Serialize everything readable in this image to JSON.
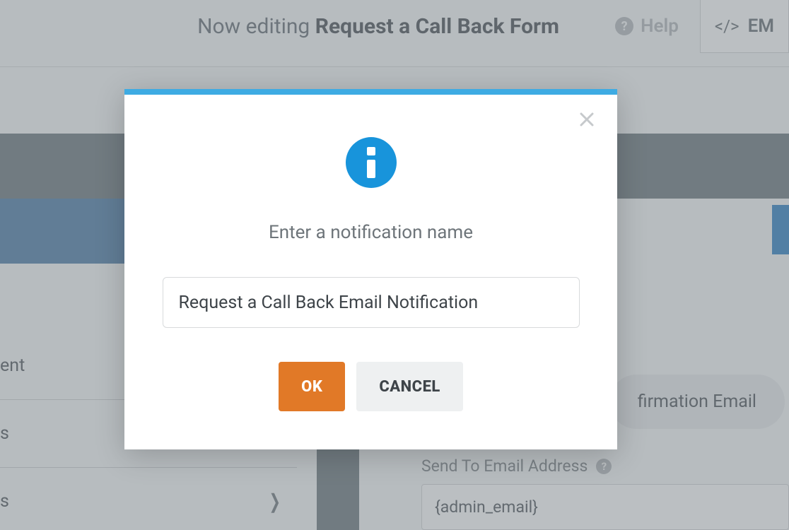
{
  "header": {
    "now_editing": "Now editing",
    "form_name": "Request a Call Back Form",
    "help_label": "Help",
    "embed_label": "EM"
  },
  "sidebar": {
    "items": [
      {
        "label": "ent"
      },
      {
        "label": "s"
      },
      {
        "label": "s"
      }
    ]
  },
  "right": {
    "tab_label": "firmation Email",
    "field_label": "Send To Email Address",
    "email_value": "{admin_email}"
  },
  "modal": {
    "title": "Enter a notification name",
    "input_value": "Request a Call Back Email Notification",
    "ok_label": "OK",
    "cancel_label": "CANCEL"
  }
}
